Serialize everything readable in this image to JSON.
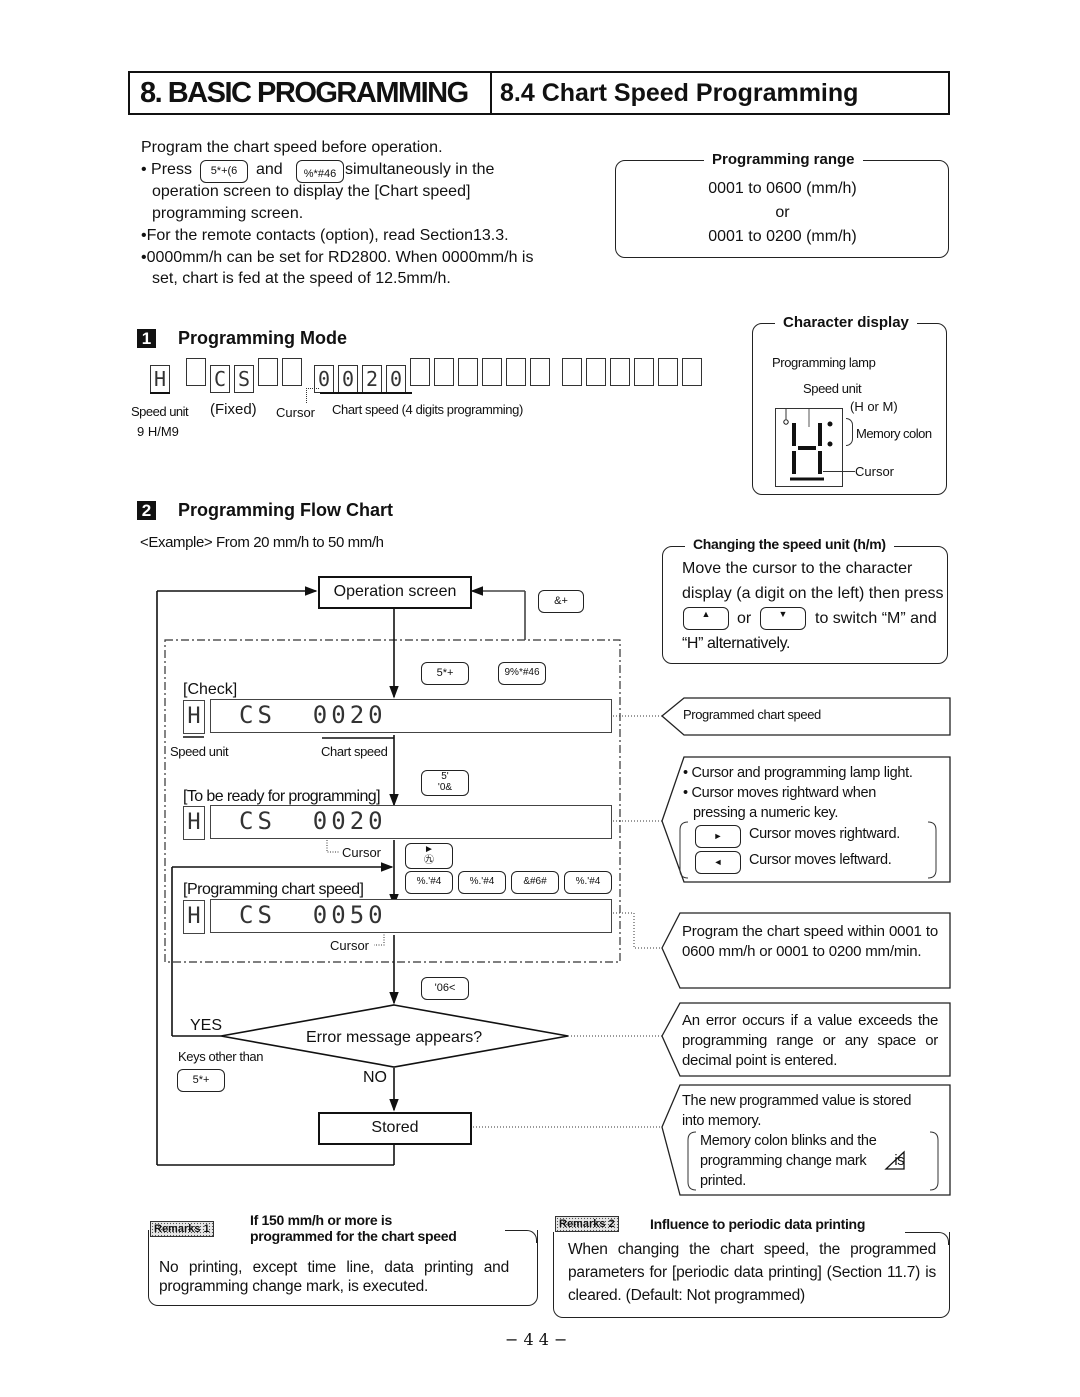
{
  "header": {
    "chapter": "8. BASIC PROGRAMMING",
    "section": "8.4 Chart Speed Programming"
  },
  "intro": {
    "line1": "Program the chart speed before operation.",
    "press_prefix": "Press",
    "key1": "5*+(6",
    "and": "and",
    "key2": "%*#46",
    "press_suffix": "simultaneously in the",
    "press_line2": "operation screen to display the [Chart speed]",
    "press_line3": "programming screen.",
    "bullet2": "For the remote contacts (option), read Section13.3.",
    "bullet3_line1": "0000mm/h can be set for RD2800. When 0000mm/h is",
    "bullet3_line2": "set, chart is fed at the speed of 12.5mm/h."
  },
  "programming_range": {
    "title": "Programming range",
    "line1": "0001 to 0600 (mm/h)",
    "or": "or",
    "line2": "0001 to 0200 (mm/h)"
  },
  "section1": {
    "number": "1",
    "title": "Programming Mode",
    "display_chars": [
      "H",
      "",
      "C",
      "S",
      "",
      "",
      "0",
      "0",
      "2",
      "0",
      "",
      "",
      "",
      "",
      "",
      "",
      "",
      "",
      "",
      "",
      "",
      ""
    ],
    "label_speed_unit": "Speed unit",
    "label_fixed": "(Fixed)",
    "label_cursor": "Cursor",
    "label_chart_speed": "Chart speed (4 digits programming)",
    "label_hm": "9  H/M9"
  },
  "character_display": {
    "title": "Character display",
    "programming_lamp": "Programming lamp",
    "speed_unit": "Speed unit",
    "h_or_m": "(H or M)",
    "memory_colon": "Memory colon",
    "cursor": "Cursor"
  },
  "section2": {
    "number": "2",
    "title": "Programming Flow Chart",
    "example": "<Example> From 20 mm/h to 50 mm/h"
  },
  "flow": {
    "operation_screen": "Operation screen",
    "key_esc": "&+",
    "key_func": "5*+",
    "key_func2": "9%*#46",
    "check_label": "[Check]",
    "check_unit": "H",
    "check_display": "CS  0020",
    "speed_unit_label": "Speed unit",
    "chart_speed_label": "Chart speed",
    "ready_label": "[To be ready for programming]",
    "ready_key": "5'\n'0&",
    "ready_display": "CS  0020",
    "cursor_label": "Cursor",
    "right_key": "►\n㊈",
    "programming_label": "[Programming chart speed]",
    "digit_keys": [
      "%.'#4",
      "%.'#4",
      "&#6#",
      "%.'#4"
    ],
    "programming_display": "CS  0050",
    "cursor_label2": "Cursor",
    "enter_key": "'06<",
    "decision": "Error message appears?",
    "yes": "YES",
    "no": "NO",
    "keys_other_than": "Keys other than",
    "keys_other_key": "5*+",
    "stored": "Stored"
  },
  "speed_unit_box": {
    "title": "Changing the speed unit (h/m)",
    "line1": "Move the cursor to the character",
    "line2": "display (a digit on the left) then press",
    "up_key": "▲",
    "or": "or",
    "down_key": "▼",
    "line3_suffix": "to switch “M” and",
    "line4": "“H” alternatively."
  },
  "callouts": {
    "programmed_chart_speed": "Programmed chart speed",
    "cursor_lamp_1": "Cursor and programming lamp light.",
    "cursor_lamp_2": "Cursor moves rightward when",
    "cursor_lamp_3": "pressing a numeric key.",
    "right_key": "►",
    "right_desc": "Cursor moves rightward.",
    "left_key": "◄",
    "left_desc": "Cursor moves leftward.",
    "range_note": "Program the chart speed within 0001 to 0600 mm/h or 0001 to 0200 mm/min.",
    "error_note": "An error occurs if a value exceeds the programming range or any space or decimal point is entered.",
    "stored_line1": "The new programmed value is stored",
    "stored_line2": "into memory.",
    "stored_sub1": "Memory colon blinks and the",
    "stored_sub2": "programming change mark",
    "stored_sub2b": "is",
    "stored_sub3": "printed."
  },
  "remarks1": {
    "tag": "Remarks 1",
    "title_line1": "If 150 mm/h or more is",
    "title_line2": "programmed for the chart speed",
    "body": "No printing, except time line, data printing and programming change mark, is executed."
  },
  "remarks2": {
    "tag": "Remarks 2",
    "title": "Influence to periodic data printing",
    "body": "When changing the chart speed, the programmed parameters for [periodic data printing] (Section 11.7) is cleared. (Default: Not programmed)"
  },
  "page_number": "− 4 4 −"
}
